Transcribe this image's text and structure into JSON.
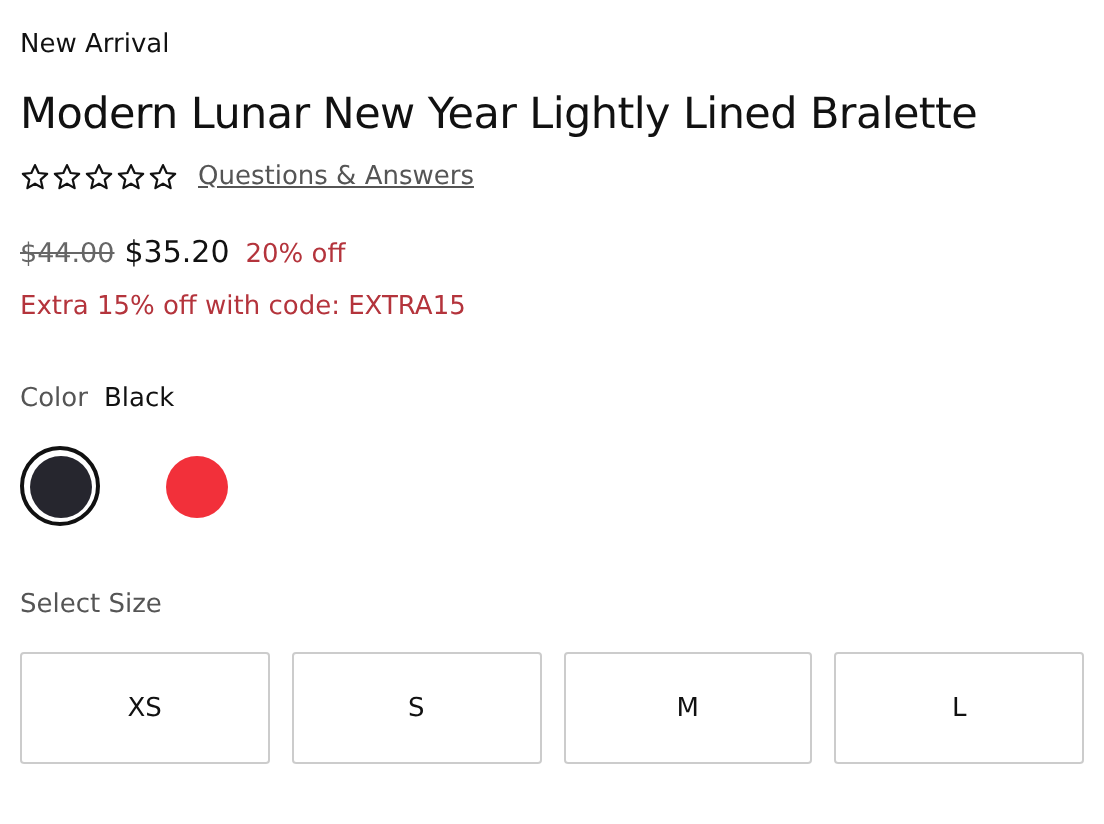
{
  "badge": "New Arrival",
  "title": "Modern Lunar New Year Lightly Lined Bralette",
  "rating": {
    "stars": 0,
    "link": "Questions & Answers"
  },
  "price": {
    "original": "$44.00",
    "current": "$35.20",
    "discount": "20% off"
  },
  "promo": "Extra 15% off with code: EXTRA15",
  "color": {
    "label": "Color",
    "value": "Black",
    "swatches": [
      {
        "color": "#26262e",
        "selected": true
      },
      {
        "color": "#f2303a",
        "selected": false
      }
    ]
  },
  "size": {
    "label": "Select Size",
    "options": [
      {
        "label": "XS",
        "selected": false
      },
      {
        "label": "S",
        "selected": false
      },
      {
        "label": "M",
        "selected": false
      },
      {
        "label": "L",
        "selected": false
      }
    ]
  }
}
